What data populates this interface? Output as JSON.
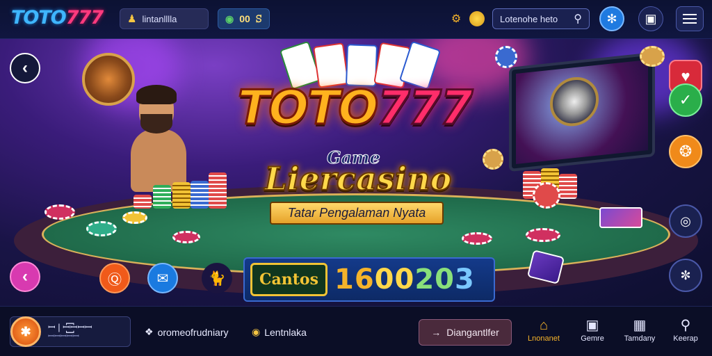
{
  "brand": {
    "logo_part1": "TOTO",
    "logo_part2": "777"
  },
  "topbar": {
    "user_pill": "lintanlllla",
    "balance": "00",
    "balance_suffix": "ꕶ",
    "search_placeholder": "Lotenohe heto",
    "icons": [
      "gear-icon",
      "coin-icon",
      "search-icon",
      "chip-icon",
      "camera-icon",
      "menu-icon"
    ]
  },
  "hero": {
    "title_part1": "TOTO",
    "title_part2": "777",
    "game_label": "Game",
    "subtitle": "Liercasino",
    "tagline": "Tatar Pengalaman Nyata",
    "jackpot_badge": "Cantos",
    "jackpot_digits_a": "16",
    "jackpot_digits_b": "00",
    "jackpot_digits_c": "20",
    "jackpot_digits_d": "3"
  },
  "bottombar": {
    "app_tile_label": "ꟷ | ꟷ꙱꙱ꟷꟷꟷ",
    "app_tile_sub": "ꟷꟷꟷꟷꟷ",
    "link1": "oromeofrudniary",
    "link2": "Lentnlaka",
    "cta_label": "Diangantlfer",
    "tabs": [
      {
        "label": "Lnonanet",
        "icon": "home-icon",
        "active": true
      },
      {
        "label": "Gemre",
        "icon": "games-icon",
        "active": false
      },
      {
        "label": "Tamdany",
        "icon": "promo-icon",
        "active": false
      },
      {
        "label": "Keerap",
        "icon": "search-icon",
        "active": false
      }
    ]
  },
  "colors": {
    "accent_gold": "#f5b32a",
    "accent_pink": "#ff2d6a",
    "accent_blue": "#3fb6ff",
    "bg_dark": "#0b1030"
  }
}
